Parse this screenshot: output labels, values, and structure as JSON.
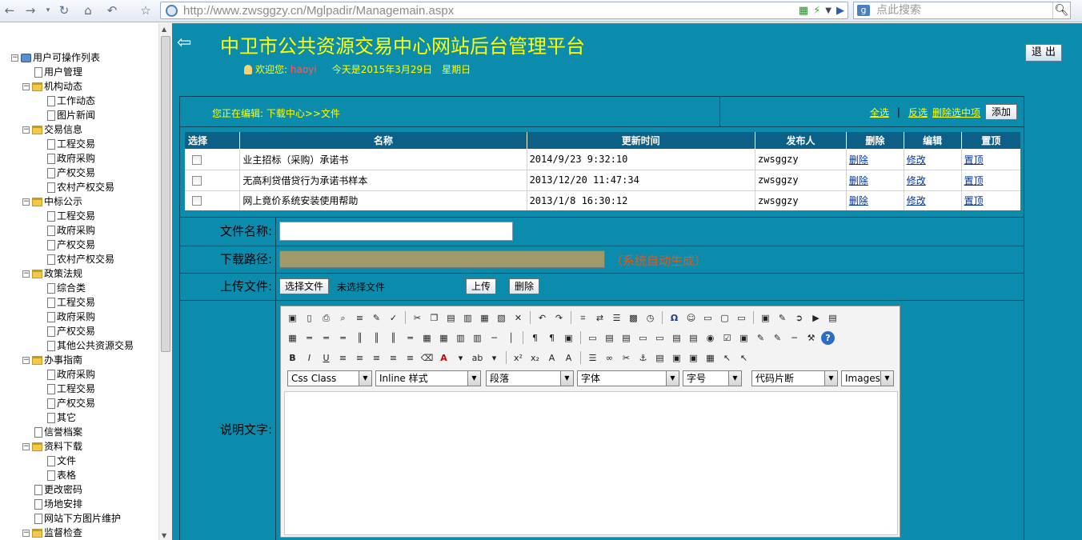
{
  "browser": {
    "url": "http://www.zwsggzy.cn/Mglpadir/Managemain.aspx",
    "search_placeholder": "点此搜索",
    "nav": {
      "back": "back-icon",
      "forward": "forward-icon",
      "refresh": "refresh-icon",
      "home": "home-icon",
      "undo": "undo-icon",
      "favorite": "star-icon"
    }
  },
  "sidebar": {
    "root": "用户可操作列表",
    "items": [
      {
        "label": "用户管理",
        "level": 1,
        "type": "page"
      },
      {
        "label": "机构动态",
        "level": 1,
        "type": "folder"
      },
      {
        "label": "工作动态",
        "level": 2,
        "type": "page"
      },
      {
        "label": "图片新闻",
        "level": 2,
        "type": "page"
      },
      {
        "label": "交易信息",
        "level": 1,
        "type": "folder"
      },
      {
        "label": "工程交易",
        "level": 2,
        "type": "page"
      },
      {
        "label": "政府采购",
        "level": 2,
        "type": "page"
      },
      {
        "label": "产权交易",
        "level": 2,
        "type": "page"
      },
      {
        "label": "农村产权交易",
        "level": 2,
        "type": "page"
      },
      {
        "label": "中标公示",
        "level": 1,
        "type": "folder"
      },
      {
        "label": "工程交易",
        "level": 2,
        "type": "page"
      },
      {
        "label": "政府采购",
        "level": 2,
        "type": "page"
      },
      {
        "label": "产权交易",
        "level": 2,
        "type": "page"
      },
      {
        "label": "农村产权交易",
        "level": 2,
        "type": "page"
      },
      {
        "label": "政策法规",
        "level": 1,
        "type": "folder"
      },
      {
        "label": "综合类",
        "level": 2,
        "type": "page"
      },
      {
        "label": "工程交易",
        "level": 2,
        "type": "page"
      },
      {
        "label": "政府采购",
        "level": 2,
        "type": "page"
      },
      {
        "label": "产权交易",
        "level": 2,
        "type": "page"
      },
      {
        "label": "其他公共资源交易",
        "level": 2,
        "type": "page"
      },
      {
        "label": "办事指南",
        "level": 1,
        "type": "folder"
      },
      {
        "label": "政府采购",
        "level": 2,
        "type": "page"
      },
      {
        "label": "工程交易",
        "level": 2,
        "type": "page"
      },
      {
        "label": "产权交易",
        "level": 2,
        "type": "page"
      },
      {
        "label": "其它",
        "level": 2,
        "type": "page"
      },
      {
        "label": "信誉档案",
        "level": 1,
        "type": "page"
      },
      {
        "label": "资料下载",
        "level": 1,
        "type": "folder"
      },
      {
        "label": "文件",
        "level": 2,
        "type": "page"
      },
      {
        "label": "表格",
        "level": 2,
        "type": "page"
      },
      {
        "label": "更改密码",
        "level": 1,
        "type": "page"
      },
      {
        "label": "场地安排",
        "level": 1,
        "type": "page"
      },
      {
        "label": "网站下方图片维护",
        "level": 1,
        "type": "page"
      },
      {
        "label": "监督检查",
        "level": 1,
        "type": "folder"
      }
    ]
  },
  "header": {
    "title": "中卫市公共资源交易中心网站后台管理平台",
    "welcome_prefix": "欢迎您:",
    "username": "haoyi",
    "date_text": "今天是2015年3月29日　星期日",
    "logout": "退 出"
  },
  "editbar": {
    "location": "您正在编辑: 下载中心>>文件",
    "select_all": "全选",
    "divider": "|",
    "invert": "反选",
    "delete_selected": "删除选中项",
    "add": "添加"
  },
  "table": {
    "headers": [
      "选择",
      "名称",
      "更新时间",
      "发布人",
      "删除",
      "编辑",
      "置顶"
    ],
    "rows": [
      {
        "name": "业主招标（采购）承诺书",
        "time": "2014/9/23 9:32:10",
        "author": "zwsggzy",
        "del": "删除",
        "edit": "修改",
        "top": "置顶"
      },
      {
        "name": "无高利贷借贷行为承诺书样本",
        "time": "2013/12/20 11:47:34",
        "author": "zwsggzy",
        "del": "删除",
        "edit": "修改",
        "top": "置顶"
      },
      {
        "name": "网上竟价系统安装使用帮助",
        "time": "2013/1/8 16:30:12",
        "author": "zwsggzy",
        "del": "删除",
        "edit": "修改",
        "top": "置顶"
      }
    ]
  },
  "form": {
    "filename_label": "文件名称:",
    "filename_value": "",
    "path_label": "下载路径:",
    "path_hint": "（系统自动生成）",
    "upload_label": "上传文件:",
    "choose_file": "选择文件",
    "no_file": "未选择文件",
    "upload": "上传",
    "delete": "删除",
    "desc_label": "说明文字:"
  },
  "editor": {
    "selects": [
      "Css Class",
      "Inline 样式",
      "段落",
      "字体",
      "字号",
      "代码片断",
      "Images"
    ]
  },
  "colors": {
    "frame": "#0c8cad",
    "title": "#ffff00",
    "table_header": "#0c5f86",
    "path_field": "#a09a6a",
    "hint": "#e05a1a"
  }
}
